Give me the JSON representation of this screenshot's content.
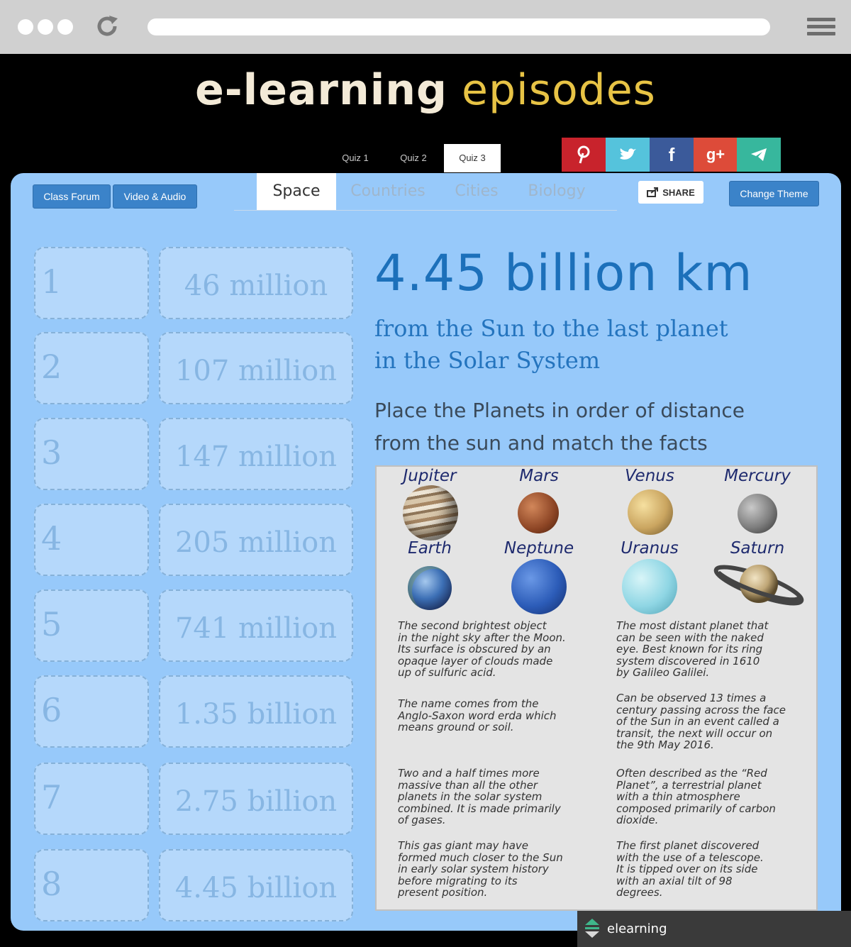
{
  "brand": {
    "part1": "e-learning",
    "part2": "episodes"
  },
  "quiz_tabs": [
    "Quiz 1",
    "Quiz 2",
    "Quiz 3"
  ],
  "social": [
    "P",
    "t",
    "f",
    "g+",
    "➤"
  ],
  "buttons": {
    "class_forum": "Class Forum",
    "video_audio": "Video & Audio",
    "share": "SHARE",
    "change_theme": "Change Theme"
  },
  "subtabs": [
    "Space",
    "Countries",
    "Cities",
    "Biology"
  ],
  "numbers": [
    "1",
    "2",
    "3",
    "4",
    "5",
    "6",
    "7",
    "8"
  ],
  "values": [
    "46 million",
    "107 million",
    "147 million",
    "205 million",
    "741 million",
    "1.35 billion",
    "2.75 billion",
    "4.45 billion"
  ],
  "headline": "4.45 billion km",
  "subtitle_line1": "from the Sun to the last planet",
  "subtitle_line2": "in the Solar System",
  "instruction_line1": "Place the Planets in order of distance",
  "instruction_line2": "from the sun and match the facts",
  "planets": [
    "Jupiter",
    "Mars",
    "Venus",
    "Mercury",
    "Earth",
    "Neptune",
    "Uranus",
    "Saturn"
  ],
  "facts": {
    "f1": [
      "The second brightest object",
      "in the night sky after the Moon.",
      "Its surface is obscured by an",
      "opaque layer of clouds made",
      "up of sulfuric acid."
    ],
    "f2": [
      "The most distant planet that",
      "can be seen with the naked",
      "eye. Best known for its ring",
      "system discovered in 1610",
      "by Galileo Galilei."
    ],
    "f3": [
      "The name comes from the",
      "Anglo-Saxon word erda which",
      "means ground or soil."
    ],
    "f4": [
      "Can be observed 13 times a",
      "century passing across the face",
      "of the Sun in an event called a",
      "transit, the next will occur on",
      "the 9th May 2016."
    ],
    "f5": [
      "Two and a half times more",
      "massive than all the other",
      "planets in the solar system",
      "combined. It is made primarily",
      "of gases."
    ],
    "f6": [
      "Often described as the “Red",
      "Planet”, a terrestrial planet",
      "with a thin atmosphere",
      "composed primarily of carbon",
      "dioxide."
    ],
    "f7": [
      "This gas giant may have",
      "formed much closer to the Sun",
      "in early solar system history",
      "before migrating to its",
      "present position."
    ],
    "f8": [
      "The first planet discovered",
      "with the use of a telescope.",
      "It is tipped over on its side",
      "with an axial tilt of 98",
      "degrees."
    ]
  },
  "footer_label": "elearning",
  "colors": {
    "pinterest": "#c8232c",
    "twitter": "#55c3dc",
    "facebook": "#3b5a9a",
    "gplus": "#dd4b39",
    "telegram": "#37b79d",
    "accent": "#1c70ba",
    "panel": "#97c9fa"
  }
}
